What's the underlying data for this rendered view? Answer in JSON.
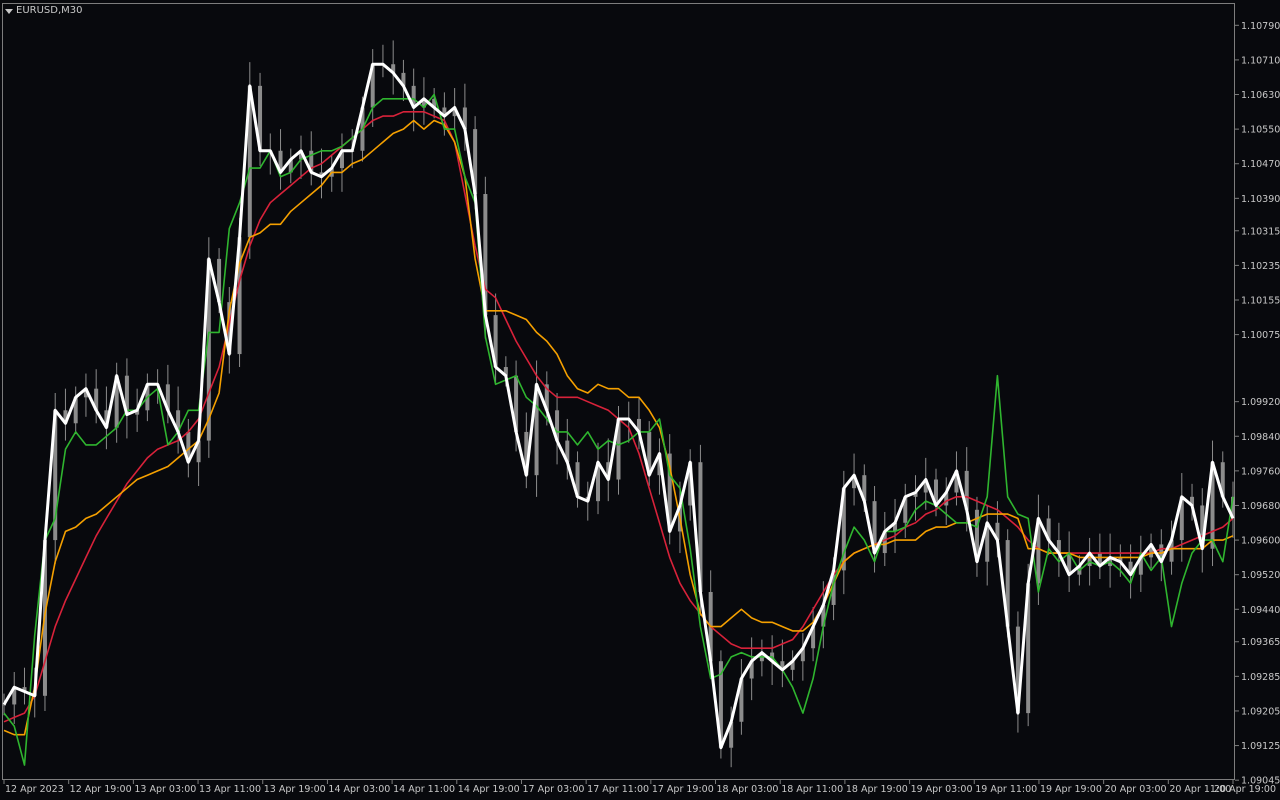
{
  "window": {
    "symbol": "EURUSD,M30"
  },
  "colors": {
    "background": "#08090d",
    "frame": "#7d7d7d",
    "candles": "#8c8c8c",
    "text": "#c8c8c8",
    "price": "#ffffff",
    "green": "#2fb52f",
    "orange": "#f5a000",
    "red": "#d8223a"
  },
  "chart_data": {
    "type": "line",
    "ylim": [
      1.0905,
      1.1083
    ],
    "yticks": [
      "1.10790",
      "1.10710",
      "1.10630",
      "1.10550",
      "1.10470",
      "1.10390",
      "1.10315",
      "1.10235",
      "1.10155",
      "1.10075",
      "1.09920",
      "1.09840",
      "1.09760",
      "1.09680",
      "1.09600",
      "1.09520",
      "1.09440",
      "1.09365",
      "1.09285",
      "1.09205",
      "1.09125",
      "1.09045"
    ],
    "xticks": [
      "12 Apr 2023",
      "12 Apr 19:00",
      "13 Apr 03:00",
      "13 Apr 11:00",
      "13 Apr 19:00",
      "14 Apr 03:00",
      "14 Apr 11:00",
      "14 Apr 19:00",
      "17 Apr 03:00",
      "17 Apr 11:00",
      "17 Apr 19:00",
      "18 Apr 03:00",
      "18 Apr 11:00",
      "18 Apr 19:00",
      "19 Apr 03:00",
      "19 Apr 11:00",
      "19 Apr 19:00",
      "20 Apr 03:00",
      "20 Apr 11:00",
      "20 Apr 19:00"
    ],
    "bar_count": 192,
    "series": [
      {
        "key": "price",
        "values": [
          1.0922,
          1.0926,
          1.0925,
          1.0924,
          1.096,
          1.099,
          1.0987,
          1.0993,
          1.0995,
          1.099,
          1.0986,
          1.0998,
          1.0989,
          1.099,
          1.0996,
          1.0996,
          1.099,
          1.0985,
          1.0978,
          1.0983,
          1.1025,
          1.1015,
          1.1003,
          1.103,
          1.1065,
          1.105,
          1.105,
          1.1045,
          1.1048,
          1.105,
          1.1045,
          1.1044,
          1.1046,
          1.105,
          1.105,
          1.106,
          1.107,
          1.107,
          1.1068,
          1.1065,
          1.106,
          1.1062,
          1.106,
          1.1058,
          1.106,
          1.1055,
          1.104,
          1.1012,
          1.1,
          1.0998,
          1.0985,
          1.0975,
          1.0996,
          1.099,
          1.0983,
          1.0978,
          1.097,
          1.0969,
          1.0978,
          1.0974,
          1.0988,
          1.0988,
          1.0985,
          1.0975,
          1.098,
          1.0962,
          1.0968,
          1.0978,
          1.0948,
          1.0932,
          1.0912,
          1.0918,
          1.0928,
          1.0932,
          1.0934,
          1.0932,
          1.093,
          1.0932,
          1.0935,
          1.094,
          1.0945,
          1.0953,
          1.0972,
          1.0975,
          1.0969,
          1.0957,
          1.0962,
          1.0964,
          1.097,
          1.0971,
          1.0974,
          1.0968,
          1.0971,
          1.0976,
          1.0967,
          1.0955,
          1.0964,
          1.096,
          1.094,
          1.092,
          1.095,
          1.0965,
          1.096,
          1.0957,
          1.0952,
          1.0954,
          1.0957,
          1.0954,
          1.0956,
          1.0955,
          1.0952,
          1.0956,
          1.0959,
          1.0955,
          1.096,
          1.097,
          1.0968,
          1.0958,
          1.0978,
          1.097,
          1.0965
        ],
        "x_start_index": 0
      },
      {
        "key": "green",
        "values": [
          1.092,
          1.0917,
          1.0908,
          1.0938,
          1.096,
          1.0965,
          1.0981,
          1.0985,
          1.0982,
          1.0982,
          1.0984,
          1.0986,
          1.099,
          1.099,
          1.0993,
          1.0995,
          1.0982,
          1.0985,
          1.099,
          1.099,
          1.1008,
          1.1008,
          1.1032,
          1.1038,
          1.1046,
          1.1046,
          1.105,
          1.1044,
          1.1045,
          1.1048,
          1.1049,
          1.105,
          1.105,
          1.1051,
          1.1053,
          1.1055,
          1.106,
          1.1062,
          1.1062,
          1.1062,
          1.1062,
          1.106,
          1.1063,
          1.1055,
          1.1055,
          1.1044,
          1.1038,
          1.1007,
          1.0996,
          1.0997,
          1.0998,
          1.0993,
          1.0991,
          1.0988,
          1.0985,
          1.0985,
          1.0982,
          1.0985,
          1.0981,
          1.0983,
          1.0982,
          1.0983,
          1.0985,
          1.0985,
          1.0988,
          1.0975,
          1.0972,
          1.0958,
          1.094,
          1.0928,
          1.0929,
          1.0933,
          1.0934,
          1.0933,
          1.0933,
          1.0933,
          1.093,
          1.0926,
          1.092,
          1.0928,
          1.094,
          1.095,
          1.0957,
          1.0963,
          1.096,
          1.0955,
          1.0962,
          1.0962,
          1.0963,
          1.0967,
          1.0969,
          1.0968,
          1.0966,
          1.0964,
          1.0964,
          1.0963,
          1.097,
          1.0998,
          1.097,
          1.0966,
          1.0965,
          1.0948,
          1.0958,
          1.0955,
          1.0957,
          1.0953,
          1.0955,
          1.0954,
          1.0955,
          1.0953,
          1.095,
          1.0957,
          1.0953,
          1.0956,
          1.094,
          1.095,
          1.0957,
          1.096,
          1.096,
          1.0955,
          1.097
        ],
        "x_start_index": 0
      },
      {
        "key": "orange",
        "values": [
          1.0916,
          1.0915,
          1.0915,
          1.0926,
          1.0943,
          1.0955,
          1.0962,
          1.0963,
          1.0965,
          1.0966,
          1.0968,
          1.097,
          1.0972,
          1.0974,
          1.0975,
          1.0976,
          1.0977,
          1.0979,
          1.0981,
          1.0983,
          1.0988,
          1.0994,
          1.1013,
          1.1024,
          1.103,
          1.1031,
          1.1033,
          1.1033,
          1.1036,
          1.1038,
          1.104,
          1.1042,
          1.1045,
          1.1045,
          1.1047,
          1.1048,
          1.105,
          1.1052,
          1.1054,
          1.1055,
          1.1057,
          1.1055,
          1.1057,
          1.1056,
          1.1052,
          1.1044,
          1.1025,
          1.1013,
          1.1013,
          1.1013,
          1.1012,
          1.1011,
          1.1008,
          1.1006,
          1.1003,
          1.0998,
          1.0995,
          1.0994,
          1.0996,
          1.0995,
          1.0995,
          1.0993,
          1.0993,
          1.099,
          1.0986,
          1.0977,
          1.0965,
          1.0952,
          1.0943,
          1.094,
          1.094,
          1.0942,
          1.0944,
          1.0942,
          1.0941,
          1.0941,
          1.094,
          1.0939,
          1.0939,
          1.0941,
          1.0945,
          1.095,
          1.0955,
          1.0957,
          1.0958,
          1.0959,
          1.0959,
          1.096,
          1.096,
          1.096,
          1.0962,
          1.0963,
          1.0963,
          1.0964,
          1.0964,
          1.0965,
          1.0966,
          1.0966,
          1.0966,
          1.0965,
          1.0958,
          1.0958,
          1.0957,
          1.0957,
          1.0957,
          1.0956,
          1.0956,
          1.0956,
          1.0956,
          1.0956,
          1.0956,
          1.0956,
          1.0957,
          1.0957,
          1.0958,
          1.0958,
          1.0958,
          1.0958,
          1.096,
          1.096,
          1.0961
        ],
        "x_start_index": 0
      },
      {
        "key": "red",
        "values": [
          1.0918,
          1.0919,
          1.092,
          1.0924,
          1.0932,
          1.094,
          1.0946,
          1.0951,
          1.0956,
          1.0961,
          1.0965,
          1.0969,
          1.0973,
          1.0976,
          1.0979,
          1.0981,
          1.0982,
          1.0983,
          1.0985,
          1.0988,
          1.0994,
          1.1,
          1.101,
          1.102,
          1.1028,
          1.1034,
          1.1038,
          1.104,
          1.1042,
          1.1044,
          1.1046,
          1.1047,
          1.1049,
          1.1051,
          1.1053,
          1.1055,
          1.1057,
          1.1058,
          1.1058,
          1.1059,
          1.1059,
          1.1059,
          1.1058,
          1.1057,
          1.1052,
          1.104,
          1.1028,
          1.1018,
          1.1016,
          1.1011,
          1.1006,
          1.1002,
          1.0998,
          1.0995,
          1.0993,
          1.0993,
          1.0993,
          1.0992,
          1.0991,
          1.099,
          1.0988,
          1.0986,
          1.098,
          1.0972,
          1.0964,
          1.0956,
          1.095,
          1.0946,
          1.0943,
          1.094,
          1.0938,
          1.0936,
          1.0935,
          1.0935,
          1.0935,
          1.0935,
          1.0936,
          1.0937,
          1.094,
          1.0944,
          1.0948,
          1.0952,
          1.0955,
          1.0957,
          1.0958,
          1.0959,
          1.096,
          1.0961,
          1.0963,
          1.0964,
          1.0966,
          1.0967,
          1.0969,
          1.097,
          1.097,
          1.0969,
          1.0968,
          1.0967,
          1.0965,
          1.0963,
          1.096,
          1.0958,
          1.0957,
          1.0957,
          1.0957,
          1.0957,
          1.0957,
          1.0957,
          1.0957,
          1.0957,
          1.0957,
          1.0957,
          1.0957,
          1.0958,
          1.0958,
          1.0959,
          1.096,
          1.0961,
          1.0962,
          1.0963,
          1.0965
        ],
        "x_start_index": 0
      }
    ]
  }
}
